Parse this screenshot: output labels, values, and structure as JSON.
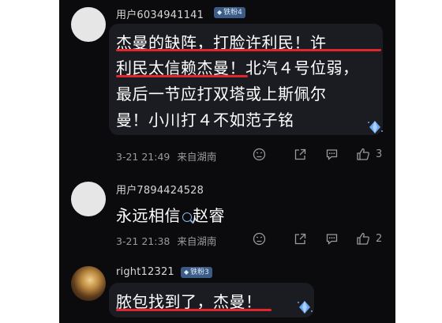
{
  "comments": [
    {
      "username": "用户6034941141",
      "badge": "铁粉4",
      "lines": [
        "杰曼的缺阵，打脸许利民！许",
        "利民太信赖杰曼！北汽４号位弱，",
        "最后一节应打双塔或上斯佩尔",
        "曼！小川打４不如范子铭"
      ],
      "date": "3-21 21:49",
      "location": "来自湖南",
      "likes": "3"
    },
    {
      "username": "用户7894424528",
      "text_before": "永远相信",
      "text_after": "赵睿",
      "date": "3-21 21:38",
      "location": "来自湖南",
      "likes": "2"
    },
    {
      "username": "right12321",
      "badge": "铁粉3",
      "text": "脓包找到了，杰曼！"
    }
  ],
  "colors": {
    "background": "#0b0b0d",
    "bubble": "#1a1c22",
    "underline": "#e1262d",
    "badge": "#3a5c86",
    "muted": "#9a9a9a"
  },
  "icons": [
    "fan-badge-diamond-icon",
    "dislike-icon",
    "share-icon",
    "reply-icon",
    "like-icon",
    "search-icon",
    "sparkle-diamond-icon"
  ]
}
